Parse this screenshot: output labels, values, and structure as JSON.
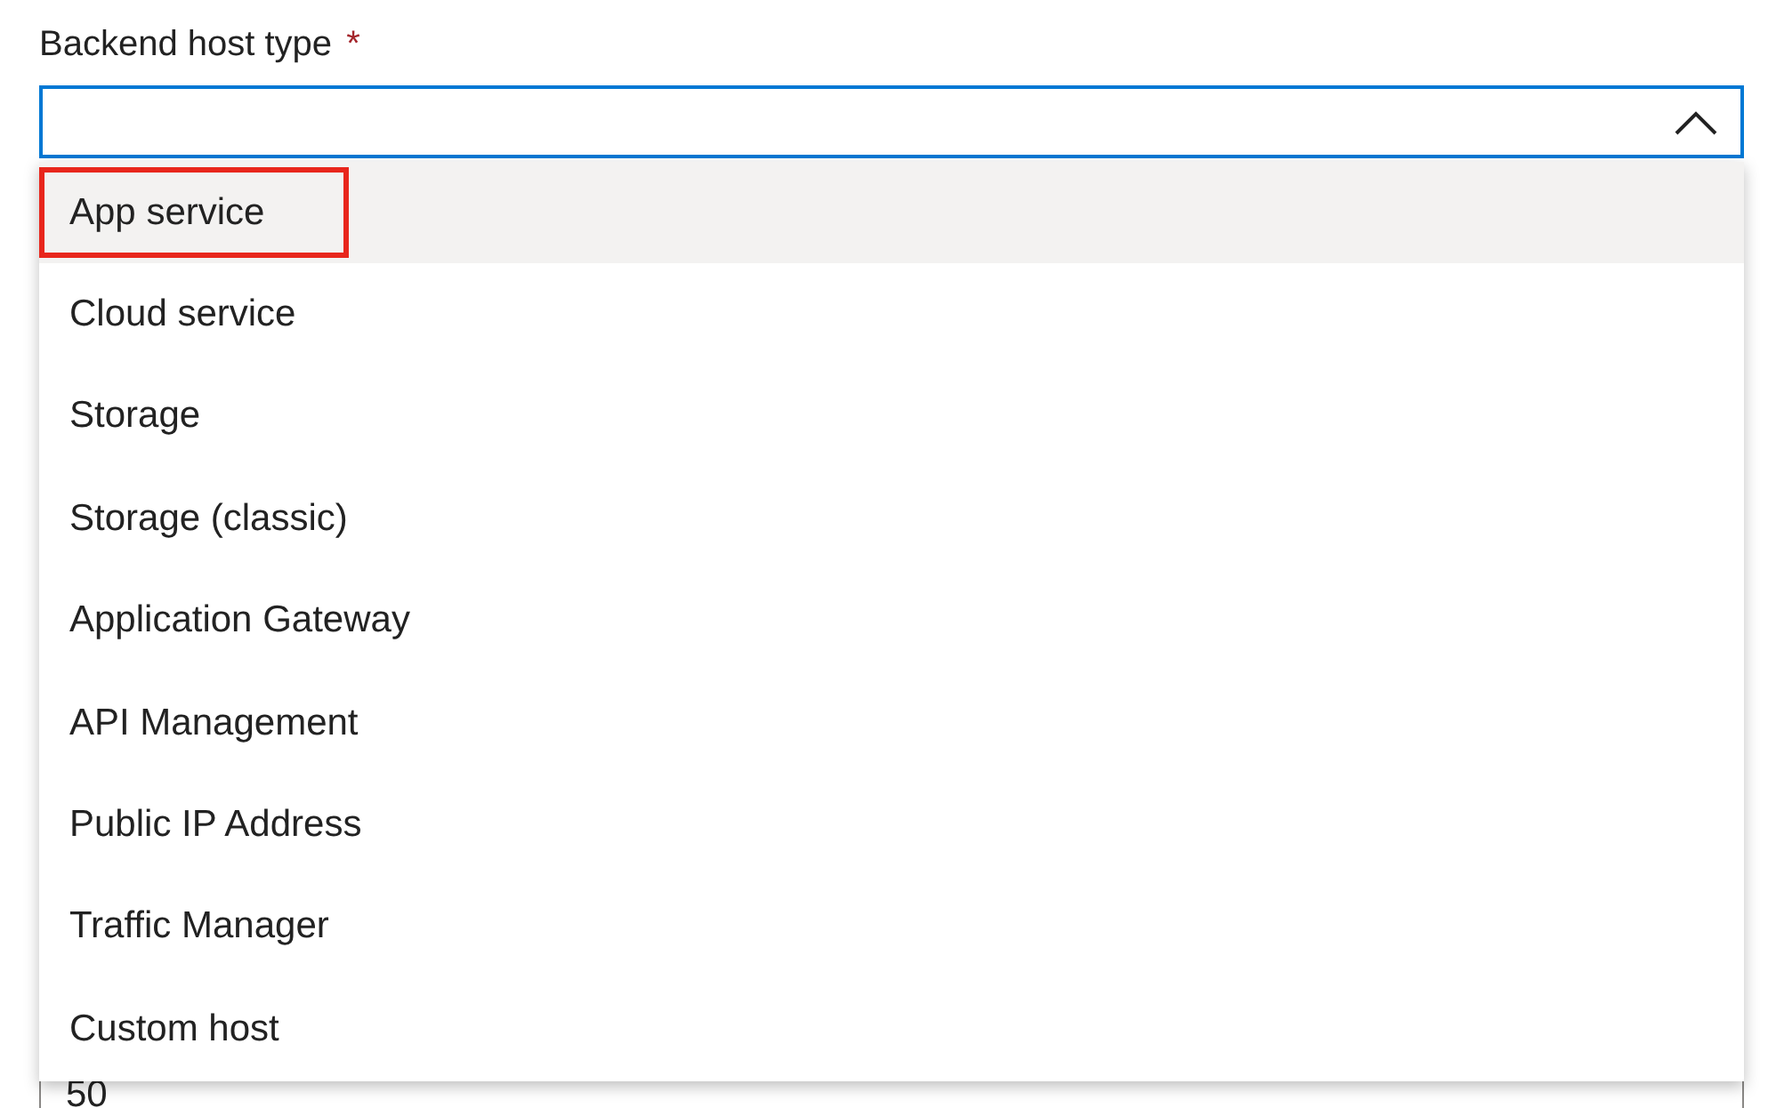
{
  "field": {
    "label": "Backend host type",
    "required_mark": "*",
    "expanded": true,
    "focused": true
  },
  "options": [
    {
      "label": "App service",
      "selected": true,
      "annotated": true
    },
    {
      "label": "Cloud service",
      "selected": false,
      "annotated": false
    },
    {
      "label": "Storage",
      "selected": false,
      "annotated": false
    },
    {
      "label": "Storage (classic)",
      "selected": false,
      "annotated": false
    },
    {
      "label": "Application Gateway",
      "selected": false,
      "annotated": false
    },
    {
      "label": "API Management",
      "selected": false,
      "annotated": false
    },
    {
      "label": "Public IP Address",
      "selected": false,
      "annotated": false
    },
    {
      "label": "Traffic Manager",
      "selected": false,
      "annotated": false
    },
    {
      "label": "Custom host",
      "selected": false,
      "annotated": false
    }
  ],
  "next_field": {
    "value": "50"
  }
}
